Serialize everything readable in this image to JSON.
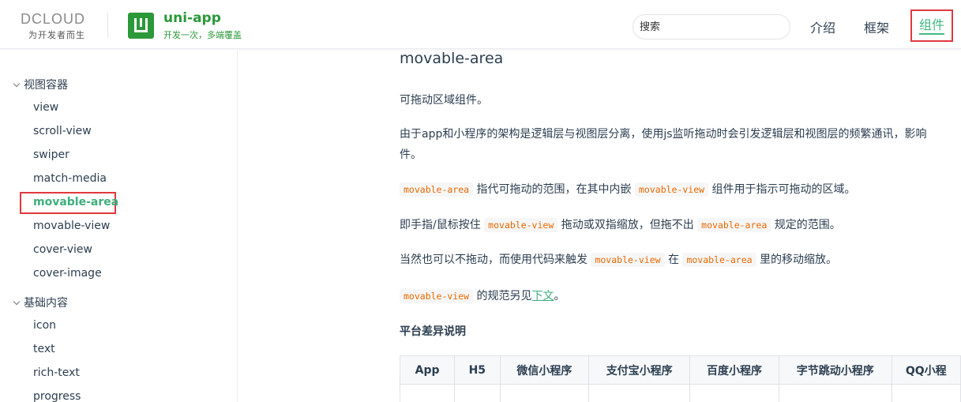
{
  "header": {
    "dcloud_logo_text": "DCLOUD",
    "dcloud_slogan": "为开发者而生",
    "uni_title": "uni-app",
    "uni_slogan": "开发一次，多端覆盖",
    "search_placeholder": "搜索",
    "nav": [
      {
        "label": "介绍"
      },
      {
        "label": "框架"
      },
      {
        "label": "组件"
      }
    ],
    "accent_color": "#42b983",
    "brand_color": "#2b9939",
    "highlight_color": "#e0393e"
  },
  "sidebar": {
    "groups": [
      {
        "title": "视图容器",
        "items": [
          {
            "label": "view"
          },
          {
            "label": "scroll-view"
          },
          {
            "label": "swiper"
          },
          {
            "label": "match-media"
          },
          {
            "label": "movable-area"
          },
          {
            "label": "movable-view"
          },
          {
            "label": "cover-view"
          },
          {
            "label": "cover-image"
          }
        ]
      },
      {
        "title": "基础内容",
        "items": [
          {
            "label": "icon"
          },
          {
            "label": "text"
          },
          {
            "label": "rich-text"
          },
          {
            "label": "progress"
          }
        ]
      }
    ]
  },
  "content": {
    "title": "movable-area",
    "p1": "可拖动区域组件。",
    "p2_line1": "由于app和小程序的架构是逻辑层与视图层分离，使用js监听拖动时会引发逻辑层和视图层的频繁通讯，影响",
    "p2_line2": "件。",
    "p3": {
      "code1": "movable-area",
      "t1": " 指代可拖动的范围，在其中内嵌 ",
      "code2": "movable-view",
      "t2": " 组件用于指示可拖动的区域。"
    },
    "p4": {
      "t1": "即手指/鼠标按住 ",
      "code1": "movable-view",
      "t2": " 拖动或双指缩放，但拖不出 ",
      "code2": "movable-area",
      "t3": " 规定的范围。"
    },
    "p5": {
      "t1": "当然也可以不拖动，而使用代码来触发 ",
      "code1": "movable-view",
      "t2": " 在 ",
      "code2": "movable-area",
      "t3": " 里的移动缩放。"
    },
    "p6": {
      "code1": "movable-view",
      "t1": " 的规范另见",
      "link": "下文",
      "t2": "。"
    },
    "section_title": "平台差异说明",
    "table": {
      "headers": [
        "App",
        "H5",
        "微信小程序",
        "支付宝小程序",
        "百度小程序",
        "字节跳动小程序",
        "QQ小程"
      ]
    }
  }
}
